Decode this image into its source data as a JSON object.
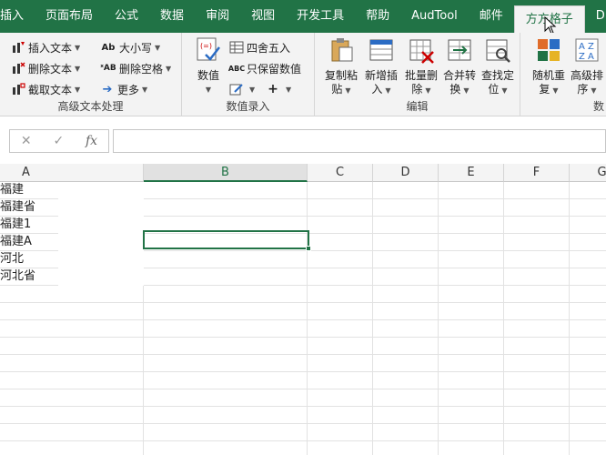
{
  "tabs": [
    "插入",
    "页面布局",
    "公式",
    "数据",
    "审阅",
    "视图",
    "开发工具",
    "帮助",
    "AudTool",
    "邮件",
    "方方格子",
    "DI"
  ],
  "active_tab": "方方格子",
  "ribbon": {
    "text_group": {
      "label": "高级文本处理",
      "insert": "插入文本",
      "delete": "删除文本",
      "extract": "截取文本",
      "case": "大小写",
      "remove_space": "删除空格",
      "more": "更多"
    },
    "value_group": {
      "label": "数值录入",
      "value_btn": "数值",
      "round": "四舍五入",
      "keep_value": "只保留数值"
    },
    "edit_group": {
      "label": "编辑",
      "copy_paste": [
        "复制粘",
        "贴"
      ],
      "new_insert": [
        "新增插",
        "入"
      ],
      "batch_delete": [
        "批量删",
        "除"
      ],
      "merge_convert": [
        "合并转",
        "换"
      ],
      "find_locate": [
        "查找定",
        "位"
      ]
    },
    "data_group": {
      "label": "数",
      "random_repeat": [
        "随机重",
        "复"
      ],
      "advanced_sort": [
        "高级排",
        "序"
      ]
    }
  },
  "formula_bar": {
    "cancel": "✕",
    "confirm": "✓",
    "fx": "fx",
    "value": ""
  },
  "columns": [
    "A",
    "B",
    "C",
    "D",
    "E",
    "F",
    "G"
  ],
  "selected_column": "B",
  "column_a_values": [
    "福建",
    "福建省",
    "福建1",
    "福建A",
    "河北",
    "河北省"
  ],
  "colors": {
    "accent": "#217346"
  }
}
